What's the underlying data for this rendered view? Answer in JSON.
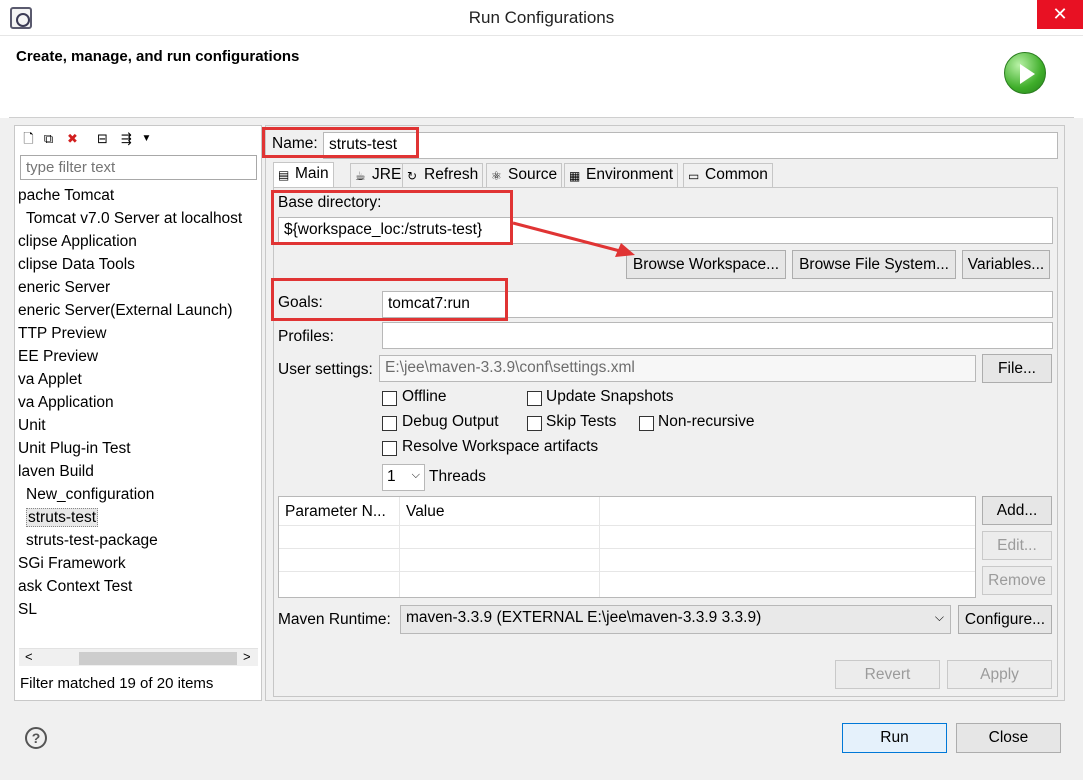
{
  "window": {
    "title": "Run Configurations",
    "close_glyph": "✕"
  },
  "header": {
    "title": "Create, manage, and run configurations"
  },
  "left": {
    "filter_placeholder": "type filter text",
    "tree": [
      {
        "label": "pache Tomcat",
        "indent": 0
      },
      {
        "label": "Tomcat v7.0 Server at localhost",
        "indent": 1
      },
      {
        "label": "clipse Application",
        "indent": 0
      },
      {
        "label": "clipse Data Tools",
        "indent": 0
      },
      {
        "label": "eneric Server",
        "indent": 0
      },
      {
        "label": "eneric Server(External Launch)",
        "indent": 0
      },
      {
        "label": "TTP Preview",
        "indent": 0
      },
      {
        "label": "EE Preview",
        "indent": 0
      },
      {
        "label": "va Applet",
        "indent": 0
      },
      {
        "label": "va Application",
        "indent": 0
      },
      {
        "label": "Unit",
        "indent": 0
      },
      {
        "label": "Unit Plug-in Test",
        "indent": 0
      },
      {
        "label": "laven Build",
        "indent": 0
      },
      {
        "label": "New_configuration",
        "indent": 1
      },
      {
        "label": "struts-test",
        "indent": 1,
        "selected": true
      },
      {
        "label": "struts-test-package",
        "indent": 1
      },
      {
        "label": "SGi Framework",
        "indent": 0
      },
      {
        "label": "ask Context Test",
        "indent": 0
      },
      {
        "label": "SL",
        "indent": 0
      }
    ],
    "status": "Filter matched 19 of 20 items",
    "scroll_left": "<",
    "scroll_right": ">"
  },
  "config": {
    "name_label": "Name:",
    "name_value": "struts-test",
    "tabs": [
      {
        "label": "Main",
        "icon": "main-tab-icon"
      },
      {
        "label": "JRE",
        "icon": "jre-tab-icon"
      },
      {
        "label": "Refresh",
        "icon": "refresh-tab-icon"
      },
      {
        "label": "Source",
        "icon": "source-tab-icon"
      },
      {
        "label": "Environment",
        "icon": "environment-tab-icon"
      },
      {
        "label": "Common",
        "icon": "common-tab-icon"
      }
    ],
    "base_dir_label": "Base directory:",
    "base_dir_value": "${workspace_loc:/struts-test}",
    "browse_workspace": "Browse Workspace...",
    "browse_fs": "Browse File System...",
    "variables": "Variables...",
    "goals_label": "Goals:",
    "goals_value": "tomcat7:run",
    "profiles_label": "Profiles:",
    "profiles_value": "",
    "user_settings_label": "User settings:",
    "user_settings_value": "E:\\jee\\maven-3.3.9\\conf\\settings.xml",
    "file_button": "File...",
    "checkboxes": {
      "offline": "Offline",
      "update_snapshots": "Update Snapshots",
      "debug_output": "Debug Output",
      "skip_tests": "Skip Tests",
      "non_recursive": "Non-recursive",
      "resolve_workspace": "Resolve Workspace artifacts"
    },
    "threads_value": "1",
    "threads_label": "Threads",
    "params_headers": [
      "Parameter N...",
      "Value"
    ],
    "add": "Add...",
    "edit": "Edit...",
    "remove": "Remove",
    "runtime_label": "Maven Runtime:",
    "runtime_value": "maven-3.3.9 (EXTERNAL E:\\jee\\maven-3.3.9 3.3.9)",
    "configure": "Configure...",
    "revert": "Revert",
    "apply": "Apply"
  },
  "footer": {
    "help_glyph": "?",
    "run": "Run",
    "close": "Close"
  },
  "colors": {
    "highlight": "#e03434",
    "arrow": "#e03434"
  }
}
